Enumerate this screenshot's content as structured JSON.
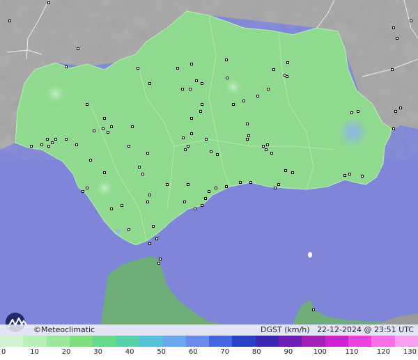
{
  "footer": {
    "brand": "Meteoclimatic",
    "copyright_symbol": "©",
    "variable": "DGST (km/h)",
    "timestamp": "22-12-2024 @ 23:51 UTC"
  },
  "scale": {
    "tick_labels": [
      "0",
      "10",
      "20",
      "30",
      "40",
      "50",
      "60",
      "70",
      "80",
      "90",
      "100",
      "110",
      "120",
      "130"
    ],
    "colors": [
      "#d4f5d4",
      "#b8f0b8",
      "#9ce89c",
      "#80e080",
      "#66d98a",
      "#5ad0a8",
      "#58c0d8",
      "#6aa8ee",
      "#6a8aee",
      "#4466e0",
      "#2a3fc8",
      "#3b28b0",
      "#6a1fb0",
      "#a020b8",
      "#d020d0",
      "#f040e0",
      "#f870e8",
      "#fca0f0"
    ]
  },
  "colors": {
    "sea": "#7f86d8",
    "land_outside": "#a6a6a6",
    "andalusia_fill": "#8fda8f",
    "morocco_fill": "#6fae7a",
    "station_marker": "#000000"
  }
}
